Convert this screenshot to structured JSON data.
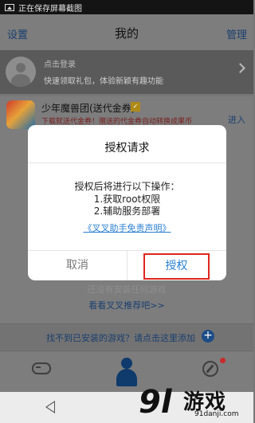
{
  "status_bar": {
    "text": "正在保存屏幕截图"
  },
  "header": {
    "settings": "设置",
    "title": "我的",
    "manage": "管理"
  },
  "login": {
    "title": "点击登录",
    "subtitle": "快速领取礼包，体验新颖有趣功能"
  },
  "game": {
    "name": "少年魔兽团(送代金券)",
    "badge": "✓",
    "desc": "下载就送代金券！赠送的代金券自动转换成果币",
    "enter": "进入"
  },
  "empty": {
    "text": "还没有安装任何游戏",
    "recommend": "看看叉叉推荐吧>>"
  },
  "add_bar": {
    "text": "找不到已安装的游戏？请点击这里添加",
    "plus": "+"
  },
  "dialog": {
    "title": "授权请求",
    "line1": "授权后将进行以下操作：",
    "line2": "1.获取root权限",
    "line3": "2.辅助服务部署",
    "link": "《叉叉助手免责声明》",
    "cancel": "取消",
    "authorize": "授权"
  },
  "watermark": {
    "logo": "9l",
    "name": "游戏",
    "url": "91danji.com"
  },
  "colors": {
    "accent": "#2a7fd4",
    "highlight": "#e0261e",
    "tab_active": "#0f3a6c"
  }
}
